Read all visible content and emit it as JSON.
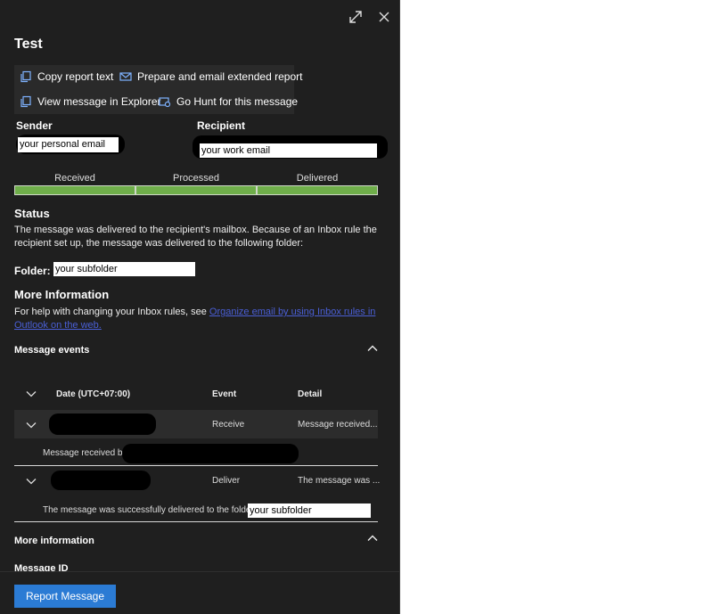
{
  "panel": {
    "title": "Test"
  },
  "actions": {
    "copy_report": "Copy report text",
    "prepare_email": "Prepare and email extended report",
    "view_explorer": "View message in Explorer",
    "go_hunt": "Go Hunt for this message"
  },
  "sender": {
    "label": "Sender",
    "value": "your personal email"
  },
  "recipient": {
    "label": "Recipient",
    "value": "your work email"
  },
  "progress": {
    "steps": [
      "Received",
      "Processed",
      "Delivered"
    ],
    "completed_steps": 3,
    "color": "#6fae4a"
  },
  "status": {
    "title": "Status",
    "text": "The message was delivered to the recipient's mailbox. Because of an Inbox rule the recipient set up, the message was delivered to the following folder:",
    "folder_label": "Folder:",
    "folder_value": "your subfolder"
  },
  "more_info": {
    "title": "More Information",
    "text": "For help with changing your Inbox rules, see ",
    "link": "Organize email by using Inbox rules in Outlook on the web."
  },
  "message_events": {
    "title": "Message events",
    "columns": {
      "date": "Date (UTC+07:00)",
      "event": "Event",
      "detail": "Detail"
    },
    "rows": [
      {
        "event": "Receive",
        "detail": "Message received...",
        "expanded_text": "Message received by:"
      },
      {
        "event": "Deliver",
        "detail": "The message was ...",
        "expanded_text": "The message was successfully delivered to the folder:",
        "folder_value": "your subfolder"
      }
    ]
  },
  "more_information": {
    "title": "More information",
    "message_id_label": "Message ID"
  },
  "footer": {
    "report_button": "Report Message"
  },
  "colors": {
    "panel_bg": "#1f1f1f",
    "accent": "#2b7bd4",
    "progress": "#6fae4a",
    "link": "#4a5fd6"
  }
}
